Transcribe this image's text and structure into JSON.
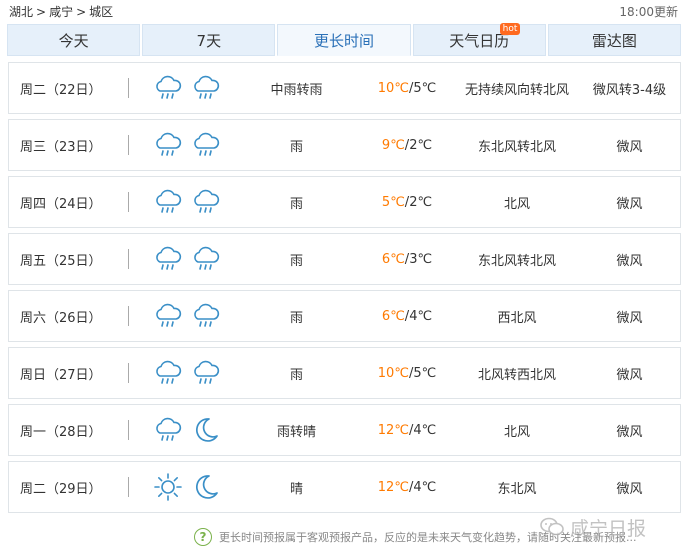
{
  "breadcrumb": {
    "items": [
      "湖北",
      "咸宁",
      "城区"
    ],
    "separator": ">"
  },
  "update_time": "18:00更新",
  "tabs": [
    {
      "label": "今天",
      "active": false
    },
    {
      "label": "7天",
      "active": false
    },
    {
      "label": "更长时间",
      "active": true
    },
    {
      "label": "天气日历",
      "active": false,
      "badge": "hot"
    },
    {
      "label": "雷达图",
      "active": false
    }
  ],
  "forecast": [
    {
      "day": "周二（22日）",
      "icon1": "rain-cloud-icon",
      "icon2": "rain-cloud-icon",
      "desc": "中雨转雨",
      "hi": "10℃",
      "lo": "5℃",
      "wind": "无持续风向转北风",
      "level": "微风转3-4级"
    },
    {
      "day": "周三（23日）",
      "icon1": "rain-cloud-icon",
      "icon2": "rain-cloud-icon",
      "desc": "雨",
      "hi": "9℃",
      "lo": "2℃",
      "wind": "东北风转北风",
      "level": "微风"
    },
    {
      "day": "周四（24日）",
      "icon1": "rain-cloud-icon",
      "icon2": "rain-cloud-icon",
      "desc": "雨",
      "hi": "5℃",
      "lo": "2℃",
      "wind": "北风",
      "level": "微风"
    },
    {
      "day": "周五（25日）",
      "icon1": "rain-cloud-icon",
      "icon2": "rain-cloud-icon",
      "desc": "雨",
      "hi": "6℃",
      "lo": "3℃",
      "wind": "东北风转北风",
      "level": "微风"
    },
    {
      "day": "周六（26日）",
      "icon1": "rain-cloud-icon",
      "icon2": "rain-cloud-icon",
      "desc": "雨",
      "hi": "6℃",
      "lo": "4℃",
      "wind": "西北风",
      "level": "微风"
    },
    {
      "day": "周日（27日）",
      "icon1": "rain-cloud-icon",
      "icon2": "rain-cloud-icon",
      "desc": "雨",
      "hi": "10℃",
      "lo": "5℃",
      "wind": "北风转西北风",
      "level": "微风"
    },
    {
      "day": "周一（28日）",
      "icon1": "rain-cloud-icon",
      "icon2": "moon-icon",
      "desc": "雨转晴",
      "hi": "12℃",
      "lo": "4℃",
      "wind": "北风",
      "level": "微风"
    },
    {
      "day": "周二（29日）",
      "icon1": "sun-icon",
      "icon2": "moon-icon",
      "desc": "晴",
      "hi": "12℃",
      "lo": "4℃",
      "wind": "东北风",
      "level": "微风"
    }
  ],
  "temp_separator": "/",
  "footer": {
    "icon": "question-icon",
    "text": "更长时间预报属于客观预报产品，反应的是未来天气变化趋势，请随时关注最新预报..."
  },
  "watermark": {
    "text": "咸宁日报",
    "icon": "wechat-icon"
  },
  "colors": {
    "high_temp": "#ff7a00",
    "active_tab": "#2b71b8",
    "icon_blue": "#3a8fc7"
  }
}
